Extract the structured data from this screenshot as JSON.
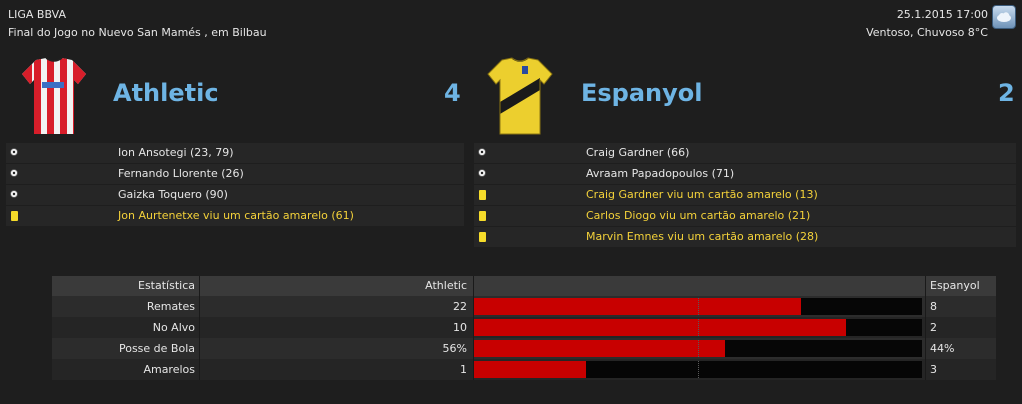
{
  "header": {
    "league": "LIGA BBVA",
    "subtitle": "Final do Jogo no Nuevo San Mamés , em Bilbau",
    "datetime": "25.1.2015 17:00",
    "weather": "Ventoso, Chuvoso 8°C"
  },
  "home": {
    "name": "Athletic",
    "score": "4",
    "events": [
      {
        "type": "goal",
        "text": "Ion Ansotegi (23, 79)"
      },
      {
        "type": "goal",
        "text": "Fernando Llorente (26)"
      },
      {
        "type": "goal",
        "text": "Gaizka Toquero (90)"
      },
      {
        "type": "yellow-card",
        "text": "Jon Aurtenetxe viu um cartão amarelo (61)"
      }
    ]
  },
  "away": {
    "name": "Espanyol",
    "score": "2",
    "events": [
      {
        "type": "goal",
        "text": "Craig Gardner (66)"
      },
      {
        "type": "goal",
        "text": "Avraam Papadopoulos (71)"
      },
      {
        "type": "yellow-card",
        "text": "Craig Gardner viu um cartão amarelo (13)"
      },
      {
        "type": "yellow-card",
        "text": "Carlos Diogo viu um cartão amarelo (21)"
      },
      {
        "type": "yellow-card",
        "text": "Marvin Emnes viu um cartão amarelo (28)"
      }
    ]
  },
  "stats": {
    "header_label": "Estatística",
    "header_home": "Athletic",
    "header_away": "Espanyol",
    "rows": [
      {
        "label": "Remates",
        "home": "22",
        "away": "8",
        "home_share": 0.73
      },
      {
        "label": "No Alvo",
        "home": "10",
        "away": "2",
        "home_share": 0.83
      },
      {
        "label": "Posse de Bola",
        "home": "56%",
        "away": "44%",
        "home_share": 0.56
      },
      {
        "label": "Amarelos",
        "home": "1",
        "away": "3",
        "home_share": 0.25
      }
    ]
  },
  "colors": {
    "accent": "#6eb4e4",
    "bar": "#c80000",
    "yellow_text": "#f4d23a"
  }
}
